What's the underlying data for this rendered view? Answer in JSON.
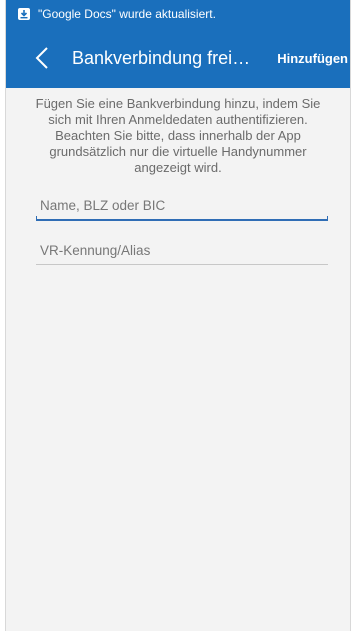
{
  "status_bar": {
    "notification_icon": "downloaded-app-icon",
    "notification_text": "\"Google Docs\" wurde aktualisiert."
  },
  "app_bar": {
    "title": "Bankverbindung frei…",
    "action_label": "Hinzufügen",
    "color": "#1a6fbc"
  },
  "main": {
    "info_text": "Fügen Sie eine Bankverbindung hinzu, indem Sie sich mit Ihren Anmeldedaten authentifizieren. Beachten Sie bitte, dass innerhalb der App grundsätzlich nur die virtuelle Handynummer angezeigt wird.",
    "bank_field": {
      "placeholder": "Name, BLZ oder BIC",
      "value": ""
    },
    "login_field": {
      "placeholder": "VR-Kennung/Alias",
      "value": ""
    }
  }
}
